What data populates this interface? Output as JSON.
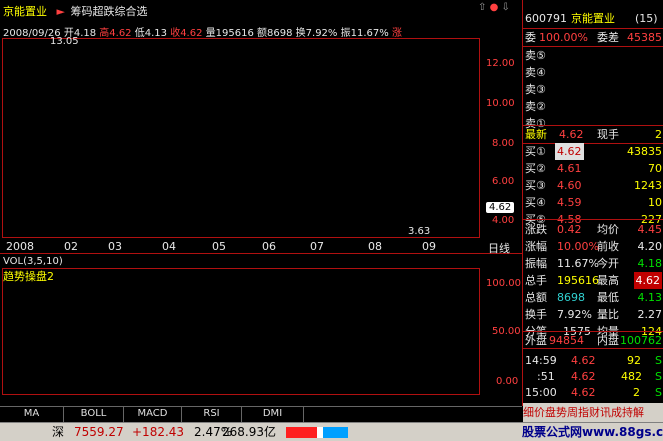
{
  "header": {
    "stock_name": "京能置业",
    "chart_name": "筹码超跌综合选",
    "date": "2008/09/26",
    "open_label": "开",
    "open": "4.18",
    "high_label": "高",
    "high": "4.62",
    "low_label": "低",
    "low": "4.13",
    "close_label": "收",
    "close": "4.62",
    "vol_label": "量",
    "vol": "195616",
    "amt_label": "额",
    "amt": "8698",
    "turnover_label": "换",
    "turnover": "7.92%",
    "amp_label": "振",
    "amp": "11.67%",
    "tail_label": "涨"
  },
  "price_chart": {
    "y_ticks": [
      "12.00",
      "10.00",
      "8.00",
      "6.00",
      "4.00"
    ],
    "current_price": "4.62",
    "high_mark": "13.05",
    "low_mark": "3.63"
  },
  "x_axis": {
    "labels": [
      "2008",
      "02",
      "03",
      "04",
      "05",
      "06",
      "07",
      "08",
      "09"
    ],
    "period": "日线"
  },
  "volume": {
    "title": "VOL(3,5,10)"
  },
  "indicator": {
    "title": "趋势操盘2",
    "y_ticks": [
      "100.00",
      "50.00",
      "0.00"
    ]
  },
  "tabs": [
    "MA",
    "BOLL",
    "MACD",
    "RSI",
    "DMI"
  ],
  "status_bar": {
    "index_name": "深",
    "index_value": "7559.27",
    "index_change": "+182.43",
    "index_pct": "2.47%",
    "amount": "268.93亿"
  },
  "quote_panel": {
    "code": "600791",
    "name": "京能置业",
    "number": "(15)",
    "webi_label": "委",
    "webi": "100.00%",
    "diff_label": "委差",
    "diff": "45385",
    "sells": [
      {
        "label": "卖⑤",
        "price": "",
        "vol": ""
      },
      {
        "label": "卖④",
        "price": "",
        "vol": ""
      },
      {
        "label": "卖③",
        "price": "",
        "vol": ""
      },
      {
        "label": "卖②",
        "price": "",
        "vol": ""
      },
      {
        "label": "卖①",
        "price": "",
        "vol": ""
      }
    ],
    "latest_label": "最新",
    "latest": "4.62",
    "now_hand_label": "现手",
    "now_hand": "2",
    "buys": [
      {
        "label": "买①",
        "price": "4.62",
        "vol": "43835"
      },
      {
        "label": "买②",
        "price": "4.61",
        "vol": "70"
      },
      {
        "label": "买③",
        "price": "4.60",
        "vol": "1243"
      },
      {
        "label": "买④",
        "price": "4.59",
        "vol": "10"
      },
      {
        "label": "买⑤",
        "price": "4.58",
        "vol": "227"
      }
    ],
    "stats": [
      {
        "l1": "涨跌",
        "v1": "0.42",
        "l2": "均价",
        "v2": "4.45"
      },
      {
        "l1": "涨幅",
        "v1": "10.00%",
        "l2": "前收",
        "v2": "4.20"
      },
      {
        "l1": "振幅",
        "v1": "11.67%",
        "l2": "今开",
        "v2": "4.18"
      },
      {
        "l1": "总手",
        "v1": "195616",
        "l2": "最高",
        "v2": "4.62"
      },
      {
        "l1": "总额",
        "v1": "8698",
        "l2": "最低",
        "v2": "4.13"
      },
      {
        "l1": "换手",
        "v1": "7.92%",
        "l2": "量比",
        "v2": "2.27"
      },
      {
        "l1": "分笔",
        "v1": "1575",
        "l2": "均量",
        "v2": "124"
      }
    ],
    "outer_label": "外盘",
    "outer": "94854",
    "inner_label": "内盘",
    "inner": "100762",
    "ticks": [
      {
        "time": "14:59",
        "price": "4.62",
        "vol": "92",
        "side": "S"
      },
      {
        "time": ":51",
        "price": "4.62",
        "vol": "482",
        "side": "S"
      },
      {
        "time": "15:00",
        "price": "4.62",
        "vol": "2",
        "side": "S"
      }
    ],
    "footer": "细价盘势周指财讯成持解"
  },
  "watermark": "股票公式网www.88gs.com",
  "colors": {
    "up": "#ff4040",
    "down": "#00e000",
    "grid": "#b01010",
    "accent": "#ffff00"
  }
}
